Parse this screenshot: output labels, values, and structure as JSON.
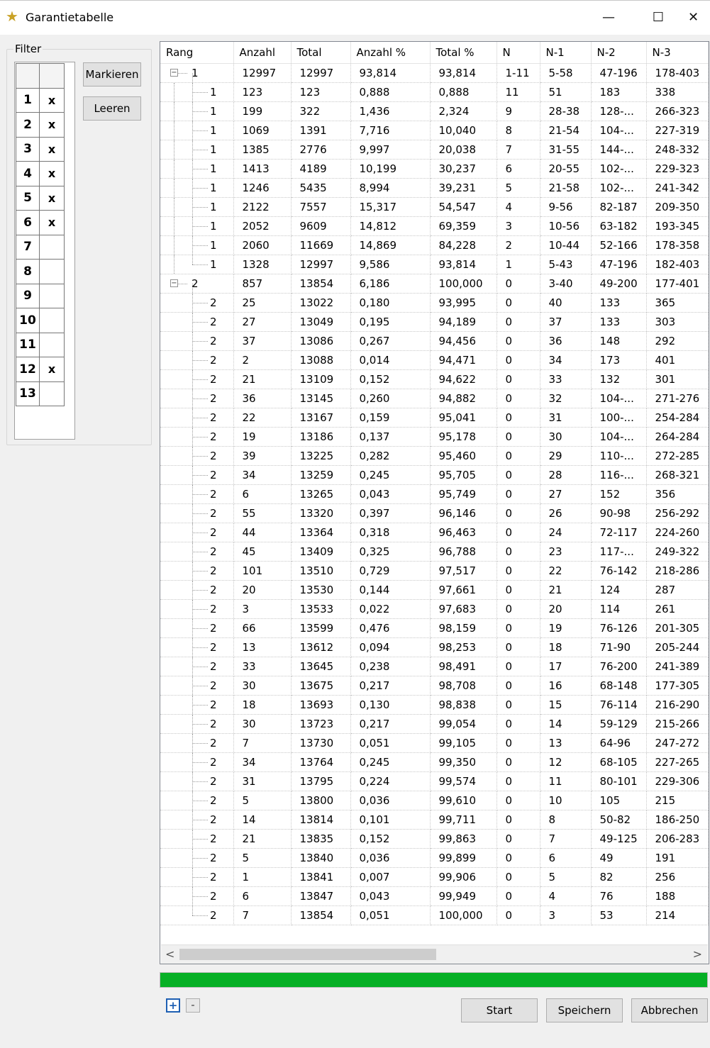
{
  "window": {
    "title": "Garantietabelle",
    "minimize": "—",
    "maximize": "☐",
    "close": "✕"
  },
  "filter": {
    "legend": "Filter",
    "rows": [
      {
        "num": "1",
        "mark": "x"
      },
      {
        "num": "2",
        "mark": "x"
      },
      {
        "num": "3",
        "mark": "x"
      },
      {
        "num": "4",
        "mark": "x"
      },
      {
        "num": "5",
        "mark": "x"
      },
      {
        "num": "6",
        "mark": "x"
      },
      {
        "num": "7",
        "mark": ""
      },
      {
        "num": "8",
        "mark": ""
      },
      {
        "num": "9",
        "mark": ""
      },
      {
        "num": "10",
        "mark": ""
      },
      {
        "num": "11",
        "mark": ""
      },
      {
        "num": "12",
        "mark": "x"
      },
      {
        "num": "13",
        "mark": ""
      }
    ],
    "buttons": {
      "mark": "Markieren",
      "clear": "Leeren"
    }
  },
  "grid": {
    "columns": [
      "Rang",
      "Anzahl",
      "Total",
      "Anzahl %",
      "Total %",
      "N",
      "N-1",
      "N-2",
      "N-3"
    ],
    "rows": [
      {
        "level": 0,
        "cells": [
          "1",
          "12997",
          "12997",
          "93,814",
          "93,814",
          "1-11",
          "5-58",
          "47-196",
          "178-403"
        ]
      },
      {
        "level": 1,
        "cells": [
          "1",
          "123",
          "123",
          "0,888",
          "0,888",
          "11",
          "51",
          "183",
          "338"
        ]
      },
      {
        "level": 1,
        "cells": [
          "1",
          "199",
          "322",
          "1,436",
          "2,324",
          "9",
          "28-38",
          "128-...",
          "266-323"
        ]
      },
      {
        "level": 1,
        "cells": [
          "1",
          "1069",
          "1391",
          "7,716",
          "10,040",
          "8",
          "21-54",
          "104-...",
          "227-319"
        ]
      },
      {
        "level": 1,
        "cells": [
          "1",
          "1385",
          "2776",
          "9,997",
          "20,038",
          "7",
          "31-55",
          "144-...",
          "248-332"
        ]
      },
      {
        "level": 1,
        "cells": [
          "1",
          "1413",
          "4189",
          "10,199",
          "30,237",
          "6",
          "20-55",
          "102-...",
          "229-323"
        ]
      },
      {
        "level": 1,
        "cells": [
          "1",
          "1246",
          "5435",
          "8,994",
          "39,231",
          "5",
          "21-58",
          "102-...",
          "241-342"
        ]
      },
      {
        "level": 1,
        "cells": [
          "1",
          "2122",
          "7557",
          "15,317",
          "54,547",
          "4",
          "9-56",
          "82-187",
          "209-350"
        ]
      },
      {
        "level": 1,
        "cells": [
          "1",
          "2052",
          "9609",
          "14,812",
          "69,359",
          "3",
          "10-56",
          "63-182",
          "193-345"
        ]
      },
      {
        "level": 1,
        "cells": [
          "1",
          "2060",
          "11669",
          "14,869",
          "84,228",
          "2",
          "10-44",
          "52-166",
          "178-358"
        ]
      },
      {
        "level": 1,
        "cells": [
          "1",
          "1328",
          "12997",
          "9,586",
          "93,814",
          "1",
          "5-43",
          "47-196",
          "182-403"
        ]
      },
      {
        "level": 0,
        "cells": [
          "2",
          "857",
          "13854",
          "6,186",
          "100,000",
          "0",
          "3-40",
          "49-200",
          "177-401"
        ]
      },
      {
        "level": 1,
        "cells": [
          "2",
          "25",
          "13022",
          "0,180",
          "93,995",
          "0",
          "40",
          "133",
          "365"
        ]
      },
      {
        "level": 1,
        "cells": [
          "2",
          "27",
          "13049",
          "0,195",
          "94,189",
          "0",
          "37",
          "133",
          "303"
        ]
      },
      {
        "level": 1,
        "cells": [
          "2",
          "37",
          "13086",
          "0,267",
          "94,456",
          "0",
          "36",
          "148",
          "292"
        ]
      },
      {
        "level": 1,
        "cells": [
          "2",
          "2",
          "13088",
          "0,014",
          "94,471",
          "0",
          "34",
          "173",
          "401"
        ]
      },
      {
        "level": 1,
        "cells": [
          "2",
          "21",
          "13109",
          "0,152",
          "94,622",
          "0",
          "33",
          "132",
          "301"
        ]
      },
      {
        "level": 1,
        "cells": [
          "2",
          "36",
          "13145",
          "0,260",
          "94,882",
          "0",
          "32",
          "104-...",
          "271-276"
        ]
      },
      {
        "level": 1,
        "cells": [
          "2",
          "22",
          "13167",
          "0,159",
          "95,041",
          "0",
          "31",
          "100-...",
          "254-284"
        ]
      },
      {
        "level": 1,
        "cells": [
          "2",
          "19",
          "13186",
          "0,137",
          "95,178",
          "0",
          "30",
          "104-...",
          "264-284"
        ]
      },
      {
        "level": 1,
        "cells": [
          "2",
          "39",
          "13225",
          "0,282",
          "95,460",
          "0",
          "29",
          "110-...",
          "272-285"
        ]
      },
      {
        "level": 1,
        "cells": [
          "2",
          "34",
          "13259",
          "0,245",
          "95,705",
          "0",
          "28",
          "116-...",
          "268-321"
        ]
      },
      {
        "level": 1,
        "cells": [
          "2",
          "6",
          "13265",
          "0,043",
          "95,749",
          "0",
          "27",
          "152",
          "356"
        ]
      },
      {
        "level": 1,
        "cells": [
          "2",
          "55",
          "13320",
          "0,397",
          "96,146",
          "0",
          "26",
          "90-98",
          "256-292"
        ]
      },
      {
        "level": 1,
        "cells": [
          "2",
          "44",
          "13364",
          "0,318",
          "96,463",
          "0",
          "24",
          "72-117",
          "224-260"
        ]
      },
      {
        "level": 1,
        "cells": [
          "2",
          "45",
          "13409",
          "0,325",
          "96,788",
          "0",
          "23",
          "117-...",
          "249-322"
        ]
      },
      {
        "level": 1,
        "cells": [
          "2",
          "101",
          "13510",
          "0,729",
          "97,517",
          "0",
          "22",
          "76-142",
          "218-286"
        ]
      },
      {
        "level": 1,
        "cells": [
          "2",
          "20",
          "13530",
          "0,144",
          "97,661",
          "0",
          "21",
          "124",
          "287"
        ]
      },
      {
        "level": 1,
        "cells": [
          "2",
          "3",
          "13533",
          "0,022",
          "97,683",
          "0",
          "20",
          "114",
          "261"
        ]
      },
      {
        "level": 1,
        "cells": [
          "2",
          "66",
          "13599",
          "0,476",
          "98,159",
          "0",
          "19",
          "76-126",
          "201-305"
        ]
      },
      {
        "level": 1,
        "cells": [
          "2",
          "13",
          "13612",
          "0,094",
          "98,253",
          "0",
          "18",
          "71-90",
          "205-244"
        ]
      },
      {
        "level": 1,
        "cells": [
          "2",
          "33",
          "13645",
          "0,238",
          "98,491",
          "0",
          "17",
          "76-200",
          "241-389"
        ]
      },
      {
        "level": 1,
        "cells": [
          "2",
          "30",
          "13675",
          "0,217",
          "98,708",
          "0",
          "16",
          "68-148",
          "177-305"
        ]
      },
      {
        "level": 1,
        "cells": [
          "2",
          "18",
          "13693",
          "0,130",
          "98,838",
          "0",
          "15",
          "76-114",
          "216-290"
        ]
      },
      {
        "level": 1,
        "cells": [
          "2",
          "30",
          "13723",
          "0,217",
          "99,054",
          "0",
          "14",
          "59-129",
          "215-266"
        ]
      },
      {
        "level": 1,
        "cells": [
          "2",
          "7",
          "13730",
          "0,051",
          "99,105",
          "0",
          "13",
          "64-96",
          "247-272"
        ]
      },
      {
        "level": 1,
        "cells": [
          "2",
          "34",
          "13764",
          "0,245",
          "99,350",
          "0",
          "12",
          "68-105",
          "227-265"
        ]
      },
      {
        "level": 1,
        "cells": [
          "2",
          "31",
          "13795",
          "0,224",
          "99,574",
          "0",
          "11",
          "80-101",
          "229-306"
        ]
      },
      {
        "level": 1,
        "cells": [
          "2",
          "5",
          "13800",
          "0,036",
          "99,610",
          "0",
          "10",
          "105",
          "215"
        ]
      },
      {
        "level": 1,
        "cells": [
          "2",
          "14",
          "13814",
          "0,101",
          "99,711",
          "0",
          "8",
          "50-82",
          "186-250"
        ]
      },
      {
        "level": 1,
        "cells": [
          "2",
          "21",
          "13835",
          "0,152",
          "99,863",
          "0",
          "7",
          "49-125",
          "206-283"
        ]
      },
      {
        "level": 1,
        "cells": [
          "2",
          "5",
          "13840",
          "0,036",
          "99,899",
          "0",
          "6",
          "49",
          "191"
        ]
      },
      {
        "level": 1,
        "cells": [
          "2",
          "1",
          "13841",
          "0,007",
          "99,906",
          "0",
          "5",
          "82",
          "256"
        ]
      },
      {
        "level": 1,
        "cells": [
          "2",
          "6",
          "13847",
          "0,043",
          "99,949",
          "0",
          "4",
          "76",
          "188"
        ]
      },
      {
        "level": 1,
        "cells": [
          "2",
          "7",
          "13854",
          "0,051",
          "100,000",
          "0",
          "3",
          "53",
          "214"
        ]
      }
    ]
  },
  "scrollbar": {
    "left": "<",
    "right": ">"
  },
  "progress": {
    "fraction": 1.0,
    "color": "#06b025"
  },
  "expand_buttons": {
    "expand": "+",
    "collapse": "-"
  },
  "footer": {
    "start": "Start",
    "save": "Speichern",
    "cancel": "Abbrechen"
  }
}
